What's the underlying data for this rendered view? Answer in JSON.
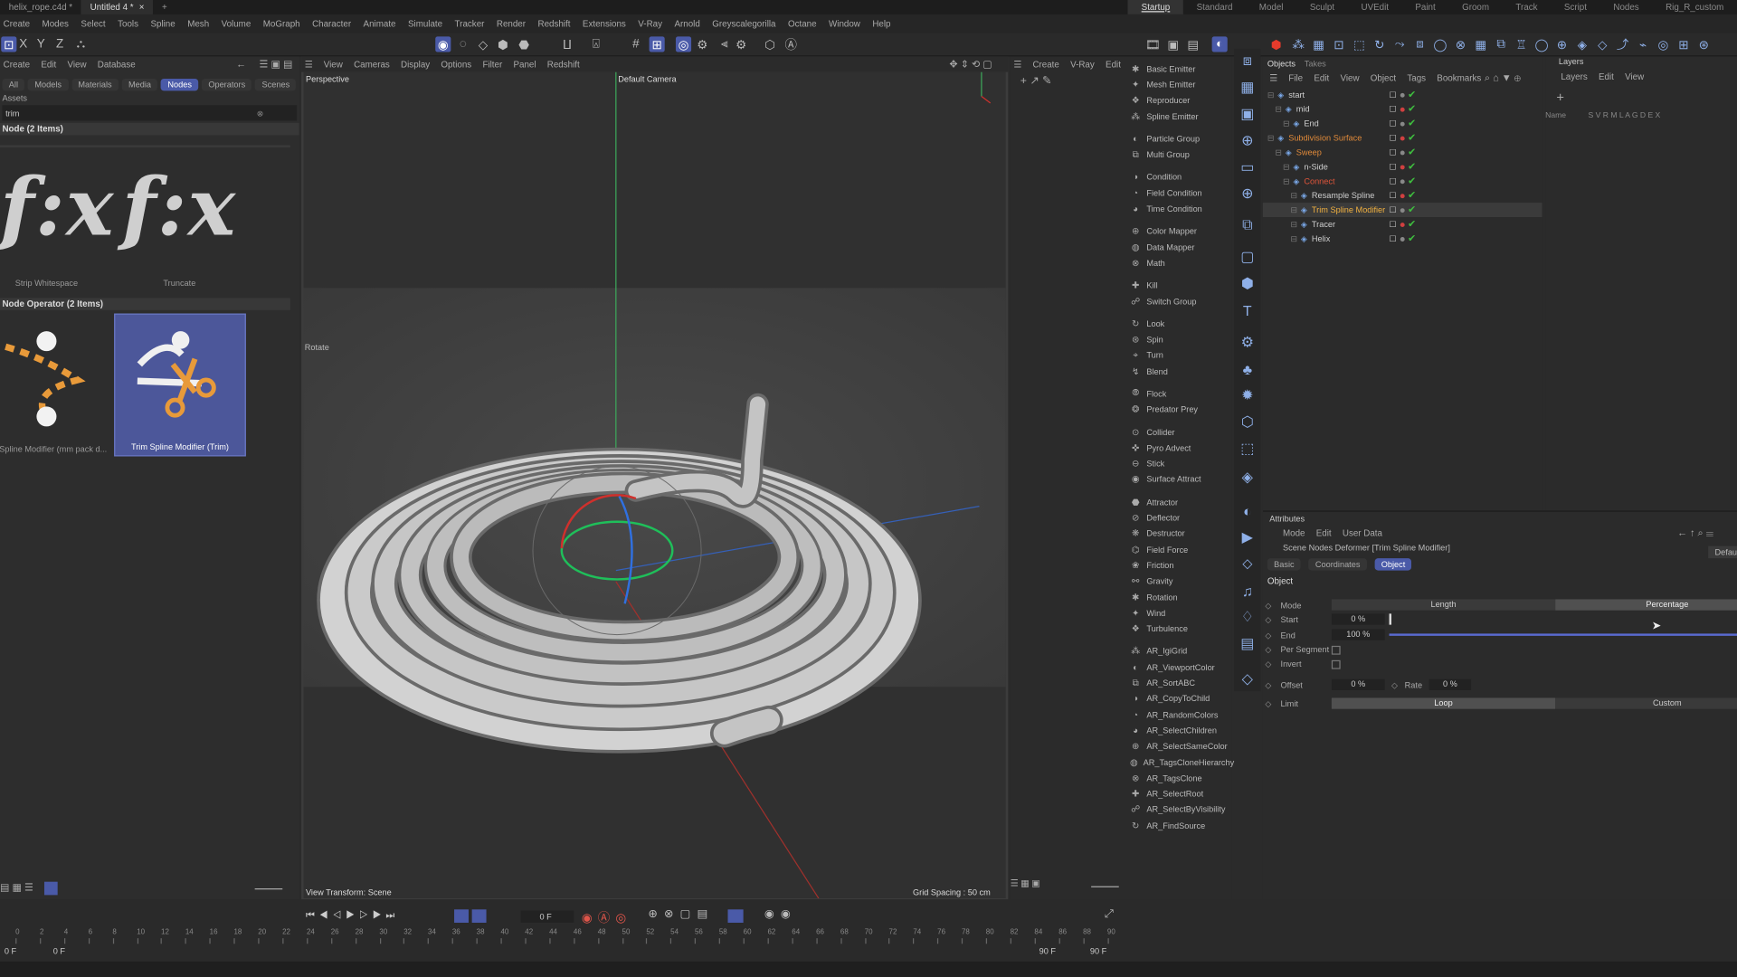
{
  "tabs": [
    "helix_rope.c4d *",
    "Untitled 4 *"
  ],
  "layouts": [
    "Startup",
    "Standard",
    "Model",
    "Sculpt",
    "UVEdit",
    "Paint",
    "Groom",
    "Track",
    "Script",
    "Nodes",
    "Rig_R_custom"
  ],
  "menu": [
    "Create",
    "Modes",
    "Select",
    "Tools",
    "Spline",
    "Mesh",
    "Volume",
    "MoGraph",
    "Character",
    "Animate",
    "Simulate",
    "Tracker",
    "Render",
    "Redshift",
    "Extensions",
    "V-Ray",
    "Arnold",
    "Greyscalegorilla",
    "Octane",
    "Window",
    "Help"
  ],
  "axis": [
    "X",
    "Y",
    "Z"
  ],
  "assetBrowser": {
    "menu": [
      "Create",
      "Edit",
      "View",
      "Database"
    ],
    "filters": [
      "All",
      "Models",
      "Materials",
      "Media",
      "Nodes",
      "Operators",
      "Scenes"
    ],
    "activeFilter": "Nodes",
    "search": "trim",
    "assets_label": "Assets",
    "section1": "Node (2 Items)",
    "items1": [
      {
        "glyph": "f:x",
        "label": "Strip Whitespace"
      },
      {
        "glyph": "f:x",
        "label": "Truncate"
      }
    ],
    "section2": "Node Operator (2 Items)",
    "items2": [
      {
        "label": "Spline Modifier (mm pack d..."
      },
      {
        "label": "Trim Spline Modifier (Trim)"
      }
    ]
  },
  "viewport": {
    "menu": [
      "View",
      "Cameras",
      "Display",
      "Options",
      "Filter",
      "Panel",
      "Redshift"
    ],
    "label": "Perspective",
    "camera": "Default Camera",
    "mode": "Rotate",
    "footer_left": "View Transform: Scene",
    "footer_right": "Grid Spacing : 50 cm"
  },
  "commander": {
    "menu": [
      "Create",
      "V-Ray",
      "Edit"
    ],
    "groups": [
      [
        "Basic Emitter",
        "Mesh Emitter",
        "Reproducer",
        "Spline Emitter"
      ],
      [
        "Particle Group",
        "Multi Group"
      ],
      [
        "Condition",
        "Field Condition",
        "Time Condition"
      ],
      [
        "Color Mapper",
        "Data Mapper",
        "Math"
      ],
      [
        "Kill",
        "Switch Group"
      ],
      [
        "Look",
        "Spin",
        "Turn",
        "Blend"
      ],
      [
        "Flock",
        "Predator Prey"
      ],
      [
        "Collider",
        "Pyro Advect",
        "Stick",
        "Surface Attract"
      ],
      [
        "Attractor",
        "Deflector",
        "Destructor",
        "Field Force",
        "Friction",
        "Gravity",
        "Rotation",
        "Wind",
        "Turbulence"
      ],
      [
        "AR_IgiGrid",
        "AR_ViewportColor",
        "AR_SortABC",
        "AR_CopyToChild",
        "AR_RandomColors",
        "AR_SelectChildren",
        "AR_SelectSameColor",
        "AR_TagsCloneHierarchy",
        "AR_TagsClone",
        "AR_SelectRoot",
        "AR_SelectByVisibility",
        "AR_FindSource"
      ]
    ]
  },
  "objects": {
    "tabs": [
      "Objects",
      "Takes"
    ],
    "menu": [
      "File",
      "Edit",
      "View",
      "Object",
      "Tags",
      "Bookmarks"
    ],
    "rows": [
      {
        "name": "start",
        "indent": 0,
        "color": "#cfcfcf"
      },
      {
        "name": "mid",
        "indent": 1,
        "color": "#cfcfcf"
      },
      {
        "name": "End",
        "indent": 2,
        "color": "#cfcfcf"
      },
      {
        "name": "Subdivision Surface",
        "indent": 0,
        "color": "#e08a3a"
      },
      {
        "name": "Sweep",
        "indent": 1,
        "color": "#e08a3a"
      },
      {
        "name": "n-Side",
        "indent": 2,
        "color": "#cfcfcf"
      },
      {
        "name": "Connect",
        "indent": 2,
        "color": "#e0553a"
      },
      {
        "name": "Resample Spline",
        "indent": 3,
        "color": "#cfcfcf"
      },
      {
        "name": "Trim Spline Modifier",
        "indent": 3,
        "color": "#f0b040"
      },
      {
        "name": "Tracer",
        "indent": 3,
        "color": "#cfcfcf"
      },
      {
        "name": "Helix",
        "indent": 3,
        "color": "#cfcfcf"
      }
    ]
  },
  "layersPanel": {
    "title": "Layers",
    "menu": [
      "Layers",
      "Edit",
      "View"
    ],
    "name_col": "Name",
    "cols": "S V R M L A G D E X"
  },
  "attributes": {
    "title": "Attributes",
    "menu": [
      "Mode",
      "Edit",
      "User Data"
    ],
    "object_label": "Scene Nodes Deformer [Trim Spline Modifier]",
    "default_btn": "Default",
    "tabs": [
      "Basic",
      "Coordinates",
      "Object"
    ],
    "activeTab": "Object",
    "section": "Object",
    "mode_label": "Mode",
    "mode_opts": [
      "Length",
      "Percentage"
    ],
    "start_label": "Start",
    "start_val": "0 %",
    "end_label": "End",
    "end_val": "100 %",
    "perseg_label": "Per Segment",
    "invert_label": "Invert",
    "offset_label": "Offset",
    "offset_val": "0 %",
    "rate_label": "Rate",
    "rate_val": "0 %",
    "limit_label": "Limit",
    "limit_opts": [
      "Loop",
      "Custom"
    ]
  },
  "timeline": {
    "frame": "0 F",
    "ticks": [
      "0",
      "2",
      "4",
      "6",
      "8",
      "10",
      "12",
      "14",
      "16",
      "18",
      "20",
      "22",
      "24",
      "26",
      "28",
      "30",
      "32",
      "34",
      "36",
      "38",
      "40",
      "42",
      "44",
      "46",
      "48",
      "50",
      "52",
      "54",
      "56",
      "58",
      "60",
      "62",
      "64",
      "66",
      "68",
      "70",
      "72",
      "74",
      "76",
      "78",
      "80",
      "82",
      "84",
      "86",
      "88",
      "90"
    ],
    "start": "0 F",
    "start2": "0 F",
    "end": "90 F",
    "end2": "90 F"
  }
}
